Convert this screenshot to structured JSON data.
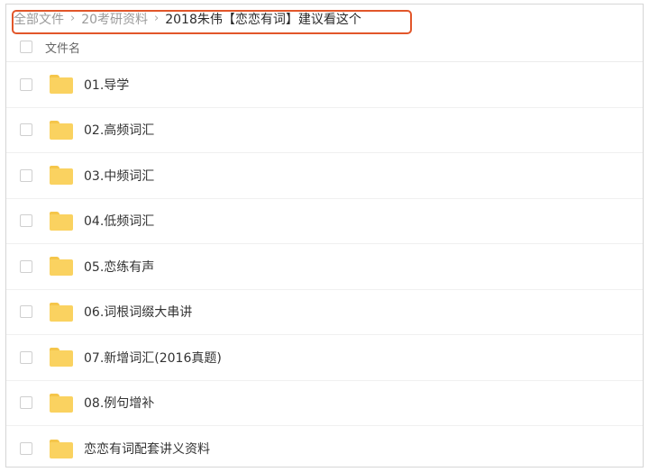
{
  "breadcrumb": {
    "root": "全部文件",
    "parent": "20考研资料",
    "current": "2018朱伟【恋恋有词】建议看这个",
    "separator": "›"
  },
  "table": {
    "column_name": "文件名"
  },
  "files": [
    {
      "name": "01.导学",
      "icon": "folder-icon"
    },
    {
      "name": "02.高频词汇",
      "icon": "folder-icon"
    },
    {
      "name": "03.中频词汇",
      "icon": "folder-icon"
    },
    {
      "name": "04.低频词汇",
      "icon": "folder-icon"
    },
    {
      "name": "05.恋练有声",
      "icon": "folder-icon"
    },
    {
      "name": "06.词根词缀大串讲",
      "icon": "folder-icon"
    },
    {
      "name": "07.新增词汇(2016真题)",
      "icon": "folder-icon"
    },
    {
      "name": "08.例句增补",
      "icon": "folder-icon"
    },
    {
      "name": "恋恋有词配套讲义资料",
      "icon": "folder-icon"
    }
  ],
  "colors": {
    "highlight": "#e2562a",
    "folder": "#fad260",
    "folder_tab": "#f5c64a"
  }
}
